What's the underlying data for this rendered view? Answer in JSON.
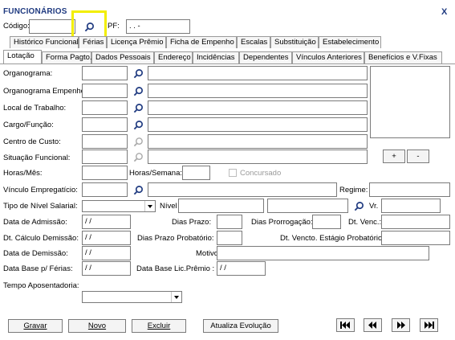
{
  "window": {
    "title": "FUNCIONÁRIOS",
    "close_label": "X"
  },
  "header": {
    "codigo_label": "Código:",
    "codigo_value": "",
    "cpf_label": "PF:",
    "cpf_value": "   .   .   -"
  },
  "tabs_row1": [
    "Histórico Funcional",
    "Férias",
    "Licença Prêmio",
    "Ficha de Empenho",
    "Escalas",
    "Substituição",
    "Estabelecimento"
  ],
  "tabs_row2": [
    "Lotação",
    "Forma Pagto.",
    "Dados Pessoais",
    "Endereço",
    "Incidências",
    "Dependentes",
    "Vínculos Anteriores",
    "Benefícios e V.Fixas"
  ],
  "active_tab": "Lotação",
  "form": {
    "organograma": "Organograma:",
    "organograma_empenho": "Organograma Empenho:",
    "local_trabalho": "Local de Trabalho:",
    "cargo_funcao": "Cargo/Função:",
    "centro_custo": "Centro de Custo:",
    "situacao_funcional": "Situação Funcional:",
    "horas_mes": "Horas/Mês:",
    "horas_semana": "Horas/Semana:",
    "concursado": "Concursado",
    "vinculo": "Vínculo Empregatício:",
    "regime": "Regime:",
    "tipo_nivel": "Tipo de Nível Salarial:",
    "nivel": "Nível",
    "vr": "Vr.",
    "data_admissao": "Data de Admissão:",
    "dias_prazo": "Dias Prazo:",
    "dias_prorrogacao": "Dias Prorrogação:",
    "dt_venc": "Dt. Venc.:",
    "dt_calculo_demissao": "Dt. Cálculo Demissão:",
    "dias_prazo_probatorio": "Dias Prazo Probatório:",
    "dt_vencto_estagio": "Dt. Vencto. Estágio Probatório:",
    "data_demissao": "Data de Demissão:",
    "motivo": "Motivo:",
    "data_base_ferias": "Data Base p/ Férias:",
    "data_base_lic": "Data Base Lic.Prêmio :",
    "tempo_aposentadoria": "Tempo Aposentadoria:",
    "date_placeholder": "/ /"
  },
  "side_buttons": {
    "add": "+",
    "remove": "-"
  },
  "footer": {
    "gravar": "Gravar",
    "novo": "Novo",
    "excluir": "Excluir",
    "atualiza": "Atualiza Evolução"
  },
  "icons": {
    "search": "magnifier-icon",
    "first": "first-record-icon",
    "prev": "previous-record-icon",
    "next": "next-record-icon",
    "last": "last-record-icon"
  },
  "colors": {
    "title": "#1f3a80",
    "highlight": "#f2ee00",
    "search_icon": "#1f3a80"
  }
}
